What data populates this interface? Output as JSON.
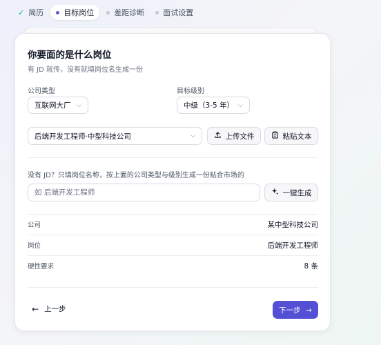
{
  "steps": [
    {
      "label": "简历",
      "state": "done",
      "icon": "check-icon"
    },
    {
      "label": "目标岗位",
      "state": "active",
      "icon": "dot-icon"
    },
    {
      "label": "差距诊断",
      "state": "pending",
      "icon": "dot-icon"
    },
    {
      "label": "面试设置",
      "state": "pending",
      "icon": "dot-icon"
    }
  ],
  "card": {
    "title": "你要面的是什么岗位",
    "subtitle": "有 JD 就传，没有就填岗位名生成一份"
  },
  "company_type": {
    "label": "公司类型",
    "value": "互联网大厂"
  },
  "target_level": {
    "label": "目标级别",
    "value": "中级（3-5 年）"
  },
  "jd_select": {
    "value": "后端开发工程师·中型科技公司"
  },
  "upload_button": {
    "label": "上传文件",
    "icon": "upload-icon"
  },
  "paste_button": {
    "label": "粘贴文本",
    "icon": "clipboard-icon"
  },
  "generate": {
    "hint": "没有 JD？只填岗位名称，按上面的公司类型与级别生成一份贴合市场的",
    "placeholder": "如 后端开发工程师",
    "button_label": "一键生成",
    "icon": "sparkle-icon"
  },
  "summary": [
    {
      "key": "公司",
      "value": "某中型科技公司"
    },
    {
      "key": "岗位",
      "value": "后端开发工程师"
    },
    {
      "key": "硬性要求",
      "value": "8 条"
    }
  ],
  "footer": {
    "back_label": "上一步",
    "next_label": "下一步"
  },
  "colors": {
    "accent": "#5450d6",
    "done": "#10b981"
  }
}
